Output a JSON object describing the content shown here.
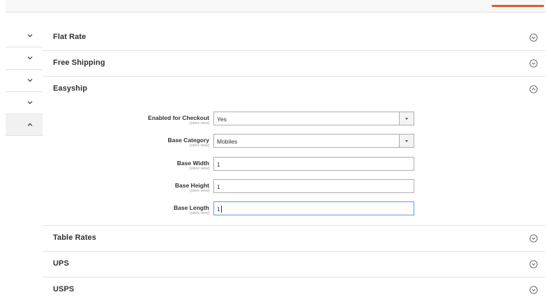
{
  "topbar": {
    "accent_color": "#e15926"
  },
  "sidebar": {
    "items": [
      {
        "icon": "chevron-down-icon",
        "state": "collapsed"
      },
      {
        "icon": "chevron-down-icon",
        "state": "collapsed"
      },
      {
        "icon": "chevron-down-icon",
        "state": "collapsed"
      },
      {
        "icon": "chevron-down-icon",
        "state": "collapsed"
      },
      {
        "icon": "chevron-up-icon",
        "state": "expanded"
      }
    ]
  },
  "sections": {
    "flat_rate": {
      "title": "Flat Rate",
      "icon": "circle-chevron-down-icon"
    },
    "free_shipping": {
      "title": "Free Shipping",
      "icon": "circle-chevron-down-icon"
    },
    "easyship": {
      "title": "Easyship",
      "icon": "circle-chevron-up-icon",
      "fields": {
        "enabled_for_checkout": {
          "label": "Enabled for Checkout",
          "scope": "[store view]",
          "value": "Yes"
        },
        "base_category": {
          "label": "Base Category",
          "scope": "[store view]",
          "value": "Mobiles"
        },
        "base_width": {
          "label": "Base Width",
          "scope": "[store view]",
          "value": "1"
        },
        "base_height": {
          "label": "Base Height",
          "scope": "[store view]",
          "value": "1"
        },
        "base_length": {
          "label": "Base Length",
          "scope": "[store view]",
          "value": "1"
        }
      }
    },
    "table_rates": {
      "title": "Table Rates",
      "icon": "circle-chevron-down-icon"
    },
    "ups": {
      "title": "UPS",
      "icon": "circle-chevron-down-icon"
    },
    "usps": {
      "title": "USPS",
      "icon": "circle-chevron-down-icon"
    }
  }
}
